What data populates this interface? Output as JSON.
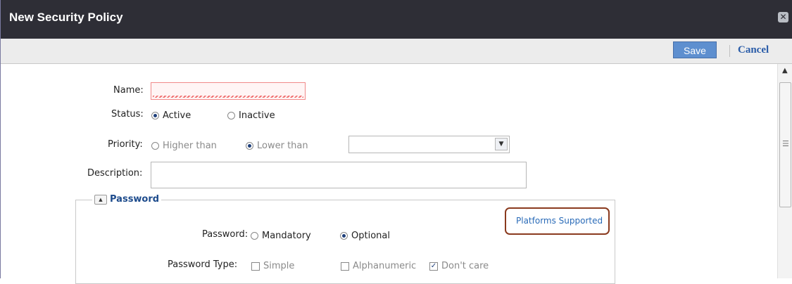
{
  "window": {
    "title": "New Security Policy"
  },
  "toolbar": {
    "save_label": "Save",
    "cancel_label": "Cancel"
  },
  "form": {
    "name_label": "Name:",
    "name_value": "",
    "status_label": "Status:",
    "status_options": [
      {
        "label": "Active",
        "selected": true
      },
      {
        "label": "Inactive",
        "selected": false
      }
    ],
    "priority_label": "Priority:",
    "priority_options": [
      {
        "label": "Higher than",
        "selected": false
      },
      {
        "label": "Lower than",
        "selected": true
      }
    ],
    "priority_select_value": "",
    "description_label": "Description:",
    "description_value": ""
  },
  "password_section": {
    "title": "Password",
    "platforms_link": "Platforms Supported",
    "password_label": "Password:",
    "password_options": [
      {
        "label": "Mandatory",
        "selected": false
      },
      {
        "label": "Optional",
        "selected": true
      }
    ],
    "password_type_label": "Password Type:",
    "password_type_options": [
      {
        "label": "Simple",
        "checked": false
      },
      {
        "label": "Alphanumeric",
        "checked": false
      },
      {
        "label": "Don't care",
        "checked": true
      }
    ]
  },
  "icons": {
    "close": "close-icon",
    "scroll_up": "scroll-up-icon",
    "collapse": "collapse-icon",
    "select_arrow": "chevron-down-icon"
  }
}
